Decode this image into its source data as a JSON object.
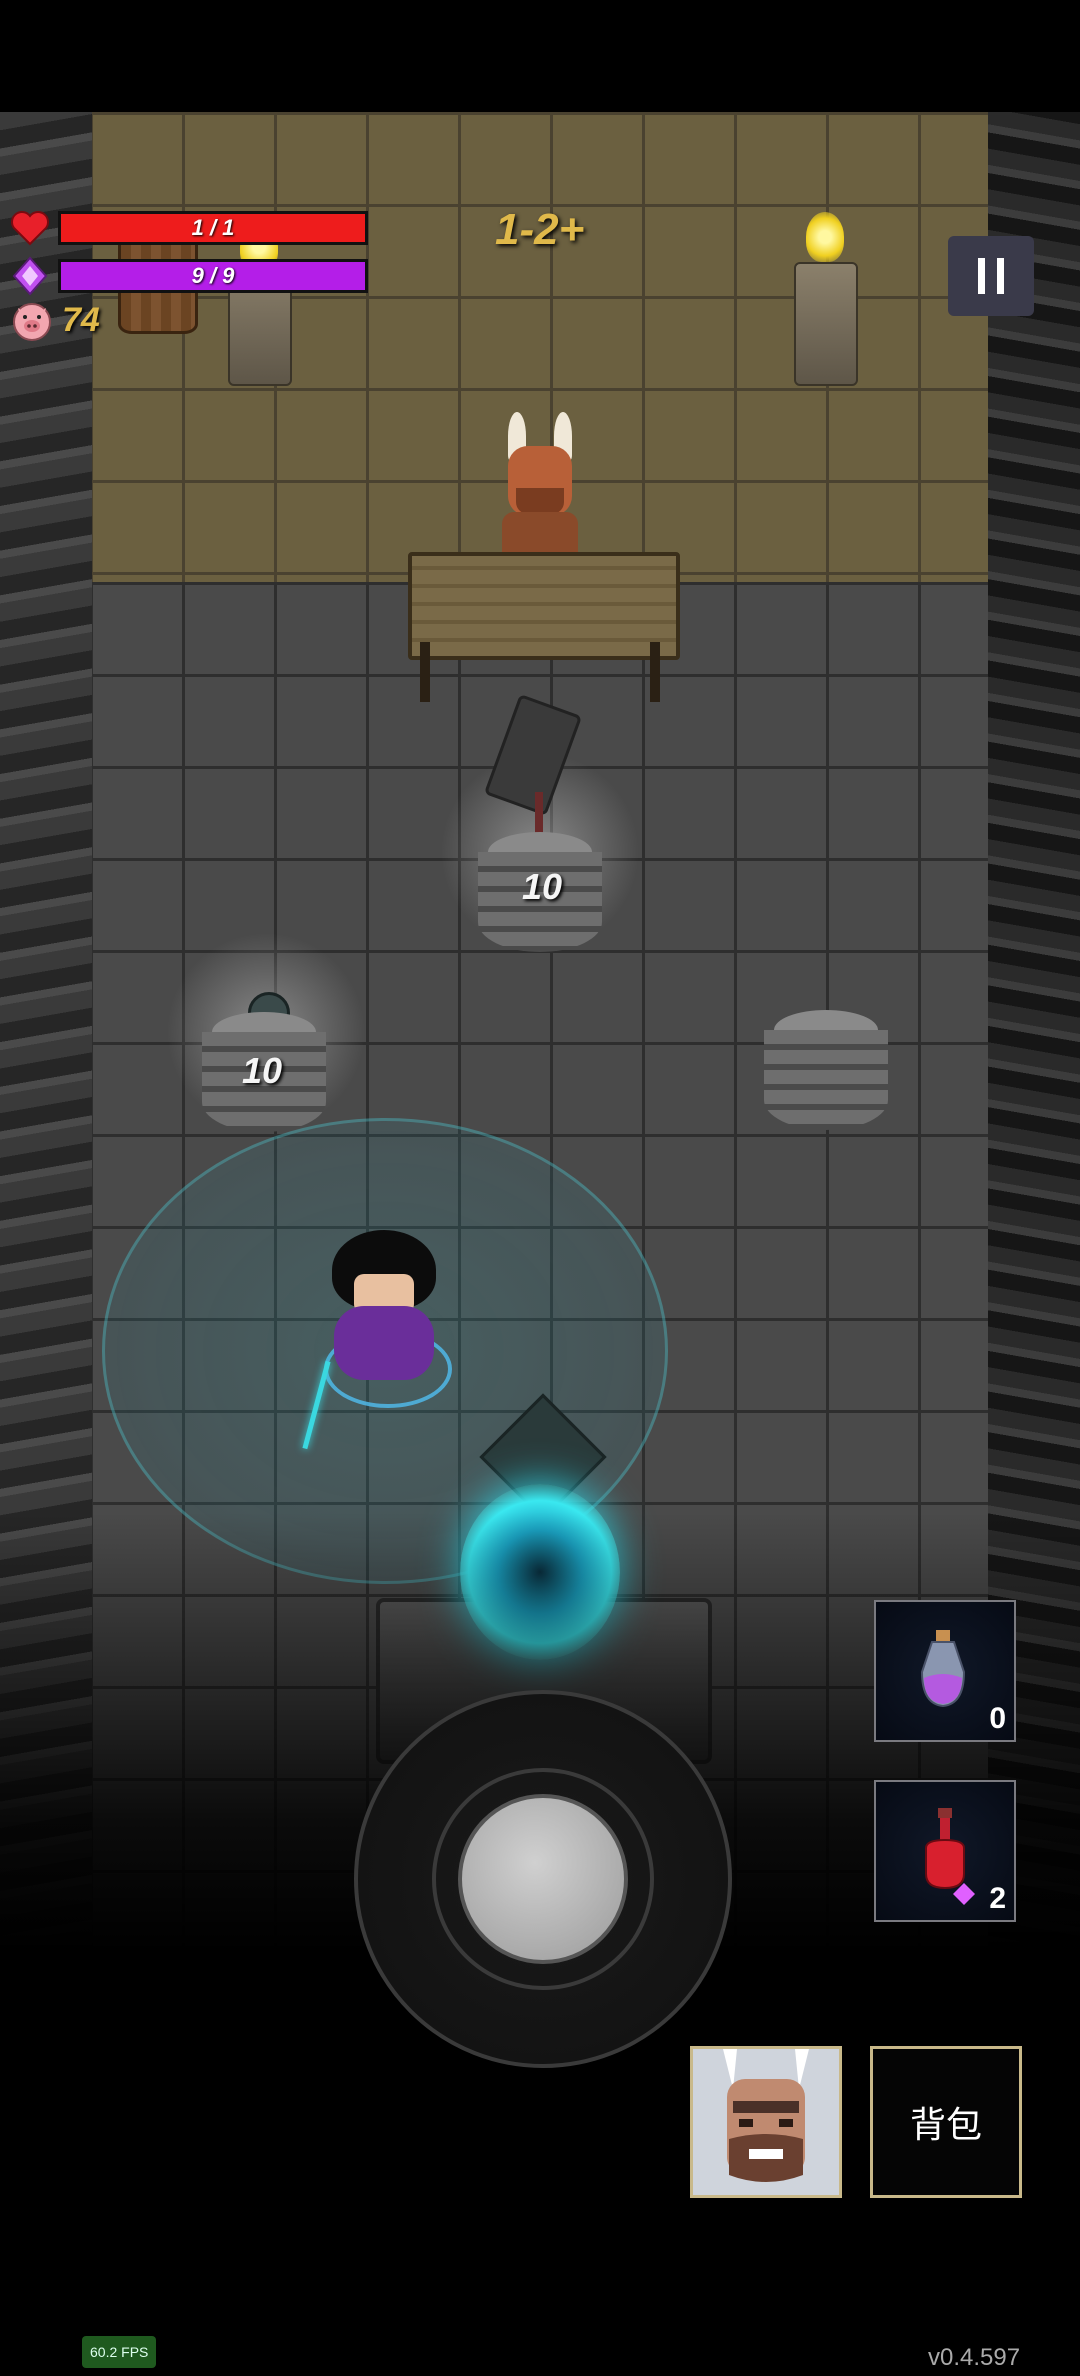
{
  "hud": {
    "health": {
      "current": 1,
      "max": 1,
      "text": "1 / 1",
      "color": "#ee1c1c"
    },
    "mana": {
      "current": 9,
      "max": 9,
      "text": "9 / 9",
      "color": "#b41ee8"
    },
    "gold": "74"
  },
  "level": "1-2+",
  "shop": {
    "items": [
      {
        "name": "hammer",
        "price": "10"
      },
      {
        "name": "mace",
        "price": "10"
      }
    ]
  },
  "potions": {
    "mana_potion": {
      "count": "0"
    },
    "health_potion": {
      "count": "2"
    }
  },
  "bag_label": "背包",
  "fps": "60.2 FPS",
  "version": "v0.4.597",
  "icons": [
    "heart-icon",
    "mana-diamond-icon",
    "pig-coin-icon",
    "pause-icon",
    "mana-potion-icon",
    "health-potion-icon"
  ]
}
